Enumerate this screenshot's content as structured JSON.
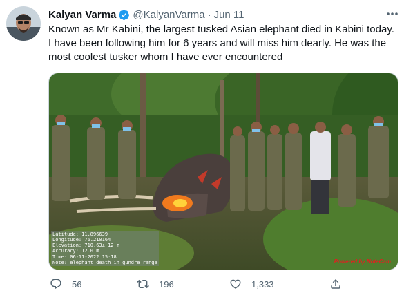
{
  "tweet": {
    "author": {
      "display_name": "Kalyan Varma",
      "handle": "@KalyanVarma",
      "verified": true
    },
    "separator": "·",
    "timestamp": "Jun 11",
    "text_lines": [
      "Known as Mr Kabini, the largest tusked Asian elephant died in Kabini today.",
      "I have been following him for 6 years and will miss him dearly. He was the",
      "most coolest tusker whom I have ever encountered"
    ],
    "media": {
      "exif_lines": [
        "Latitude: 11.896639",
        "Longitude: 76.210164",
        "Elevation: 710.63± 12 m",
        "Accuracy: 12.0 m",
        "Time: 06-11-2022 15:18",
        "Note: elephant death in gundre range"
      ],
      "watermark": "Powered by NoteCam"
    },
    "actions": {
      "reply_count": "56",
      "retweet_count": "196",
      "like_count": "1,333"
    }
  },
  "icons": {
    "verified": "verified-badge-icon",
    "more": "more-icon",
    "reply": "reply-icon",
    "retweet": "retweet-icon",
    "like": "heart-icon",
    "share": "share-icon"
  },
  "colors": {
    "verified": "#1d9bf0",
    "secondary_text": "#536471",
    "primary_text": "#0f1419"
  }
}
